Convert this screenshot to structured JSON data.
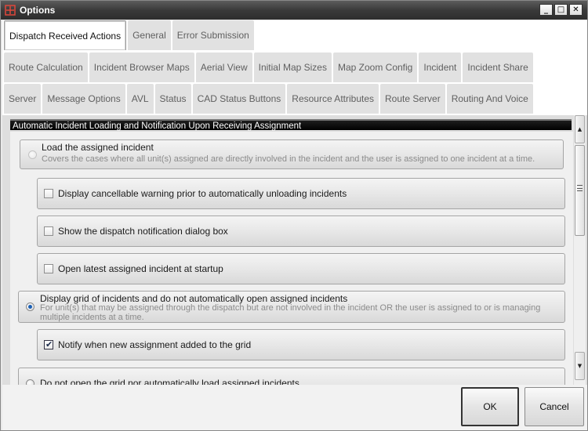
{
  "window": {
    "title": "Options",
    "controls": {
      "minimize": "_",
      "maximize": "□",
      "close": "✕"
    }
  },
  "tabs": {
    "row1": [
      "Dispatch Received Actions",
      "General",
      "Error Submission"
    ],
    "row2": [
      "Route Calculation",
      "Incident Browser Maps",
      "Aerial View",
      "Initial Map Sizes",
      "Map Zoom Config",
      "Incident",
      "Incident Share"
    ],
    "row3": [
      "Server",
      "Message Options",
      "AVL",
      "Status",
      "CAD Status Buttons",
      "Resource Attributes",
      "Route Server",
      "Routing And Voice"
    ],
    "active": "Dispatch Received Actions"
  },
  "group": {
    "header": "Automatic Incident Loading and Notification Upon Receiving Assignment",
    "opt_load": {
      "label": "Load the assigned incident",
      "description": "Covers the cases where all unit(s) assigned are directly involved in the incident and the user is assigned to one incident at a time.",
      "selected": false
    },
    "chk_cancel_warning": {
      "label": "Display cancellable warning prior to automatically unloading incidents",
      "checked": false
    },
    "chk_show_dialog": {
      "label": "Show the dispatch notification dialog box",
      "checked": false
    },
    "chk_open_latest": {
      "label": "Open latest assigned incident at startup",
      "checked": false
    },
    "opt_grid": {
      "label": "Display grid of incidents and do not automatically open assigned incidents",
      "description": "For unit(s) that may be assigned through the dispatch but are not involved in the incident OR the user is assigned to or is managing multiple incidents at a time.",
      "selected": true
    },
    "chk_notify": {
      "label": "Notify when new assignment added to the grid",
      "checked": true,
      "mark": "✔"
    },
    "opt_no_grid": {
      "label": "Do not open the grid nor automatically load assigned incidents",
      "selected": false
    }
  },
  "buttons": {
    "ok": "OK",
    "cancel": "Cancel"
  },
  "icons": {
    "app": "options-app-icon",
    "scroll_up": "▲",
    "scroll_down": "▼"
  },
  "colors": {
    "titlebar": "#3a3a3a",
    "accent": "#1a5fb4",
    "group_header": "#000000"
  }
}
